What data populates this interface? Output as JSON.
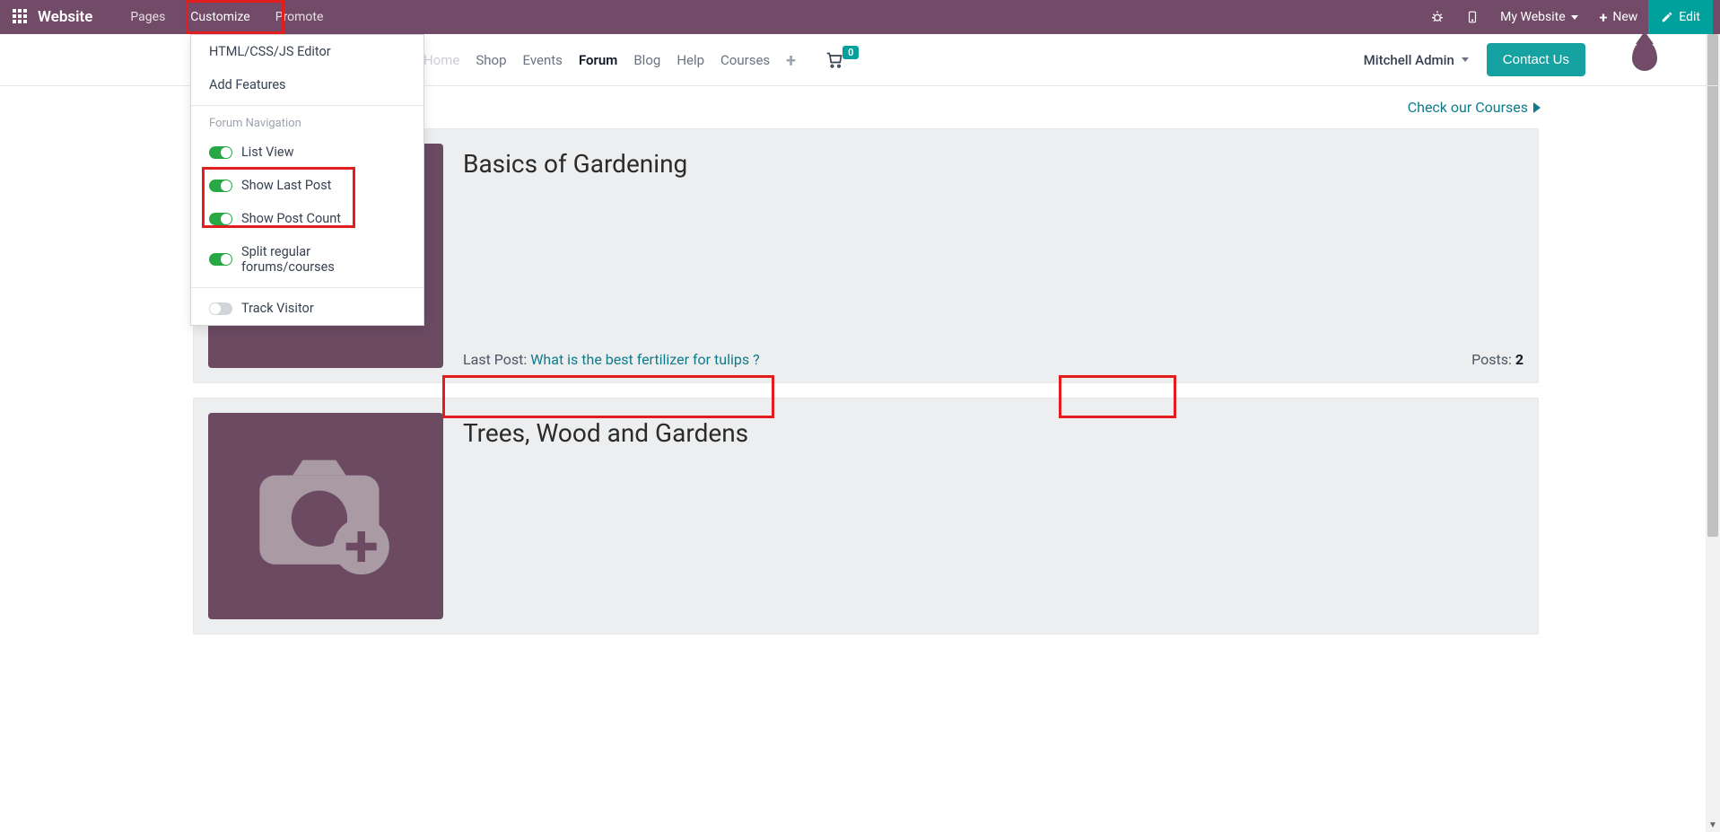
{
  "topbar": {
    "brand": "Website",
    "menu": [
      "Pages",
      "Customize",
      "Promote"
    ],
    "active_menu_index": 1,
    "my_website": "My Website",
    "new": "New",
    "edit": "Edit"
  },
  "dropdown": {
    "items_top": [
      "HTML/CSS/JS Editor",
      "Add Features"
    ],
    "section_header": "Forum Navigation",
    "toggles": [
      {
        "label": "List View",
        "on": true
      },
      {
        "label": "Show Last Post",
        "on": true
      },
      {
        "label": "Show Post Count",
        "on": true
      },
      {
        "label": "Split regular forums/courses",
        "on": true
      }
    ],
    "toggles2": [
      {
        "label": "Track Visitor",
        "on": false
      }
    ]
  },
  "navbar2": {
    "links": [
      "Home",
      "Shop",
      "Events",
      "Forum",
      "Blog",
      "Help",
      "Courses"
    ],
    "active_index": 3,
    "cart_count": "0",
    "user": "Mitchell Admin",
    "contact": "Contact Us"
  },
  "subline": {
    "courses_link": "Check our Courses"
  },
  "forums": [
    {
      "title": "Basics of Gardening",
      "last_post_label": "Last Post: ",
      "last_post_link": "What is the best fertilizer for tulips ?",
      "posts_label": "Posts: ",
      "posts_count": "2"
    },
    {
      "title": "Trees, Wood and Gardens",
      "last_post_label": "",
      "last_post_link": "",
      "posts_label": "",
      "posts_count": ""
    }
  ]
}
